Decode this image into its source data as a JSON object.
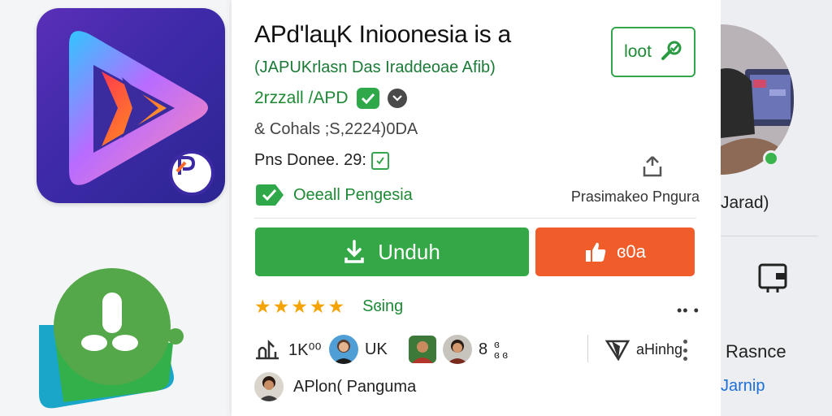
{
  "app": {
    "title": "APd'laцK Inioonesia is a",
    "subtitle": "(JAPUKrlasn Das Iraddeoae Afib)",
    "developer": "2rzzall /APD",
    "info_line_1": "& Cohals ;S,2224)0DA",
    "info_line_2": "Pns Donee. 29:",
    "pengesia_label": "Oeeall Pengesia",
    "share_label": "Prasimakeo Pngura"
  },
  "actions": {
    "loot_label": "loot",
    "download_label": "Unduh",
    "secondary_label": "ɞ0a"
  },
  "rating": {
    "stars": 5,
    "label": "Sɞing",
    "more": "•• •"
  },
  "people": {
    "item1": "1K⁰⁰",
    "item2": "UK",
    "item3_top": "8",
    "item3_lines": [
      "ɞ",
      "ɞ ɞ"
    ],
    "item4": "aHinhg"
  },
  "owner": {
    "name": "APlon( Panguma"
  },
  "side_panel": {
    "label1": "Jarad)",
    "label2": "Rasnce",
    "link": "Jarnip"
  },
  "colors": {
    "accent_green": "#34a846",
    "accent_orange": "#f05c2a",
    "star": "#f4a300",
    "link_blue": "#1d6fd6"
  }
}
